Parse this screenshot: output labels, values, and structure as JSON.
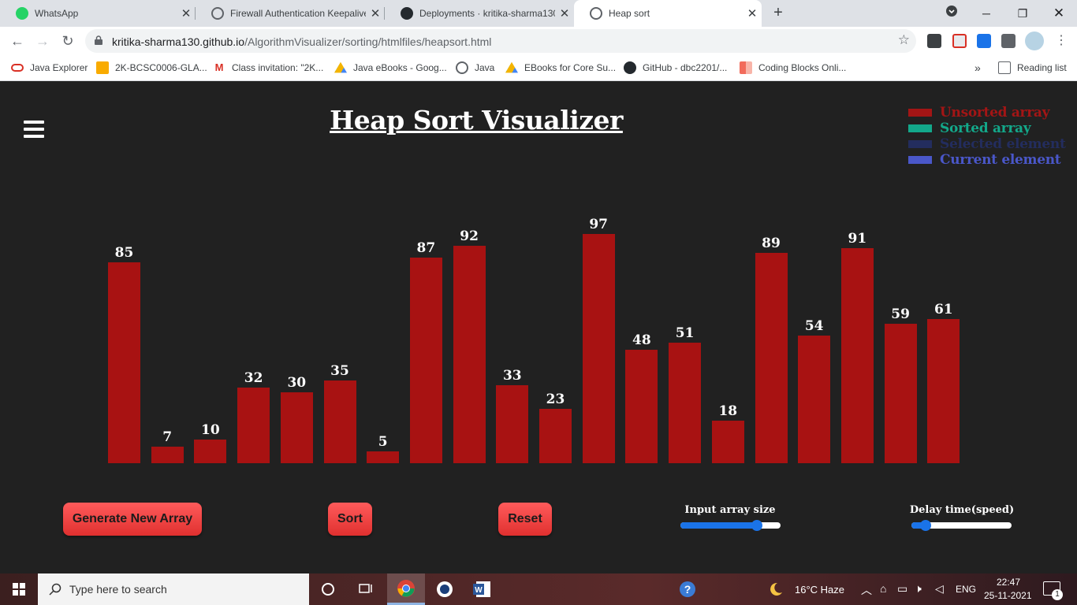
{
  "browser": {
    "tabs": [
      {
        "title": "WhatsApp",
        "icon": "whatsapp-icon",
        "active": false
      },
      {
        "title": "Firewall Authentication Keepalive",
        "icon": "globe-icon",
        "active": false
      },
      {
        "title": "Deployments · kritika-sharma130",
        "icon": "github-icon",
        "active": false
      },
      {
        "title": "Heap sort",
        "icon": "globe-icon",
        "active": true
      }
    ],
    "url_host": "kritika-sharma130.github.io",
    "url_path": "/AlgorithmVisualizer/sorting/htmlfiles/heapsort.html",
    "bookmarks": [
      {
        "label": "Java Explorer",
        "icon": "oval-icon"
      },
      {
        "label": "2K-BCSC0006-GLA...",
        "icon": "classroom-icon"
      },
      {
        "label": "Class invitation: \"2K...",
        "icon": "gmail-icon"
      },
      {
        "label": "Java eBooks - Goog...",
        "icon": "drive-icon"
      },
      {
        "label": "Java",
        "icon": "globe-icon"
      },
      {
        "label": "EBooks for Core Su...",
        "icon": "drive-icon"
      },
      {
        "label": "GitHub - dbc2201/...",
        "icon": "github-icon"
      },
      {
        "label": "Coding Blocks Onli...",
        "icon": "codingblocks-icon"
      }
    ],
    "overflow_label": "»",
    "reading_list_label": "Reading list"
  },
  "page": {
    "title": "Heap Sort Visualizer",
    "legend": [
      {
        "label": "Unsorted array",
        "color": "#a31515"
      },
      {
        "label": "Sorted array",
        "color": "#13a88a"
      },
      {
        "label": "Selected element",
        "color": "#232d5e"
      },
      {
        "label": "Current element",
        "color": "#4a57c9"
      }
    ],
    "buttons": {
      "generate": "Generate New Array",
      "sort": "Sort",
      "reset": "Reset"
    },
    "sliders": {
      "size_label": "Input array size",
      "size_value": 0.76,
      "speed_label": "Delay time(speed)",
      "speed_value": 0.14
    }
  },
  "chart_data": {
    "type": "bar",
    "values": [
      85,
      7,
      10,
      32,
      30,
      35,
      5,
      87,
      92,
      33,
      23,
      97,
      48,
      51,
      18,
      89,
      54,
      91,
      59,
      61
    ],
    "bar_color": "#a81212",
    "ylim": [
      0,
      100
    ]
  },
  "taskbar": {
    "search_placeholder": "Type here to search",
    "weather": "16°C  Haze",
    "language": "ENG",
    "time": "22:47",
    "date": "25-11-2021",
    "notification_count": "1"
  }
}
